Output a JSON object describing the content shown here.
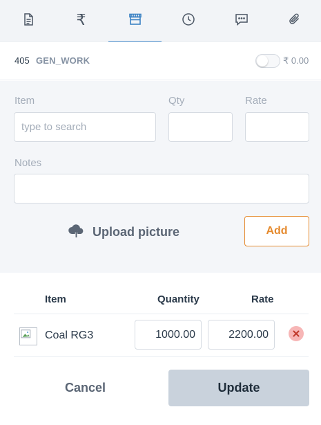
{
  "tabs": [
    {
      "icon": "document-icon"
    },
    {
      "icon": "rupee-icon",
      "glyph": "₹"
    },
    {
      "icon": "store-icon",
      "active": true
    },
    {
      "icon": "clock-icon"
    },
    {
      "icon": "chat-icon"
    },
    {
      "icon": "paperclip-icon"
    }
  ],
  "work_order": {
    "number": "405",
    "code": "GEN_WORK",
    "toggle_on": false,
    "amount": "₹ 0.00"
  },
  "form": {
    "item_label": "Item",
    "item_placeholder": "type to search",
    "item_value": "",
    "qty_label": "Qty",
    "qty_value": "",
    "rate_label": "Rate",
    "rate_value": "",
    "notes_label": "Notes",
    "notes_value": "",
    "upload_label": "Upload picture",
    "add_label": "Add"
  },
  "table": {
    "headers": {
      "item": "Item",
      "quantity": "Quantity",
      "rate": "Rate"
    },
    "rows": [
      {
        "item": "Coal RG3",
        "quantity": "1000.00",
        "rate": "2200.00"
      }
    ]
  },
  "footer": {
    "cancel_label": "Cancel",
    "update_label": "Update"
  },
  "colors": {
    "accent": "#3b82c4",
    "add_orange": "#e58a2e",
    "delete_bg": "#f7b6b6",
    "delete_x": "#c0392b",
    "update_bg": "#c9d2dc",
    "form_bg": "#f4f6f9"
  }
}
